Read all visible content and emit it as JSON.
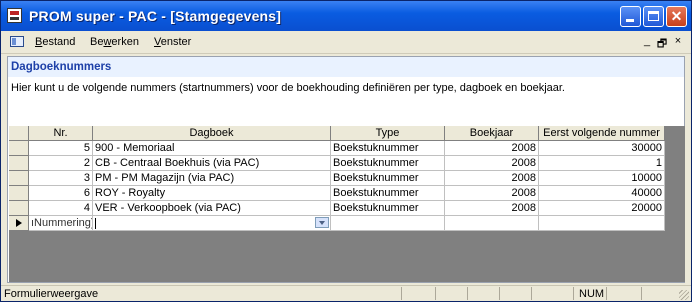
{
  "window": {
    "title": "PROM super - PAC - [Stamgegevens]",
    "close_glyph": "✕"
  },
  "menu": {
    "items": [
      {
        "underline": "B",
        "rest": "estand"
      },
      {
        "underline": "",
        "pre": "Be",
        "u": "w",
        "post": "erken"
      },
      {
        "underline": "V",
        "rest": "enster"
      }
    ],
    "child_controls": [
      "_",
      "🗗",
      "×"
    ]
  },
  "form": {
    "section_title": "Dagboeknummers",
    "info_text": "Hier kunt u de volgende nummers (startnummers) voor de boekhouding definiëren per type, dagboek en boekjaar."
  },
  "table": {
    "columns": [
      "Nr.",
      "Dagboek",
      "Type",
      "Boekjaar",
      "Eerst volgende nummer"
    ],
    "rows": [
      {
        "nr": "5",
        "dagboek": "900 - Memoriaal",
        "type": "Boekstuknummer",
        "boekjaar": "2008",
        "nummer": "30000"
      },
      {
        "nr": "2",
        "dagboek": "CB - Centraal Boekhuis (via PAC)",
        "type": "Boekstuknummer",
        "boekjaar": "2008",
        "nummer": "1"
      },
      {
        "nr": "3",
        "dagboek": "PM - PM Magazijn (via PAC)",
        "type": "Boekstuknummer",
        "boekjaar": "2008",
        "nummer": "10000"
      },
      {
        "nr": "6",
        "dagboek": "ROY - Royalty",
        "type": "Boekstuknummer",
        "boekjaar": "2008",
        "nummer": "40000"
      },
      {
        "nr": "4",
        "dagboek": "VER - Verkoopboek (via PAC)",
        "type": "Boekstuknummer",
        "boekjaar": "2008",
        "nummer": "20000"
      }
    ],
    "new_row_nr": "ıNummering)"
  },
  "status": {
    "text": "Formulierweergave",
    "num": "NUM"
  },
  "colors": {
    "title_bar": "#0a5ce1",
    "section_header_text": "#1d40a8",
    "section_header_bg": "#e9f2ff"
  },
  "icons": [
    "app-icon",
    "menu-document-icon",
    "minimize-icon",
    "maximize-icon",
    "close-icon",
    "record-selector-arrow-icon",
    "dropdown-arrow-icon",
    "resize-grip-icon"
  ]
}
